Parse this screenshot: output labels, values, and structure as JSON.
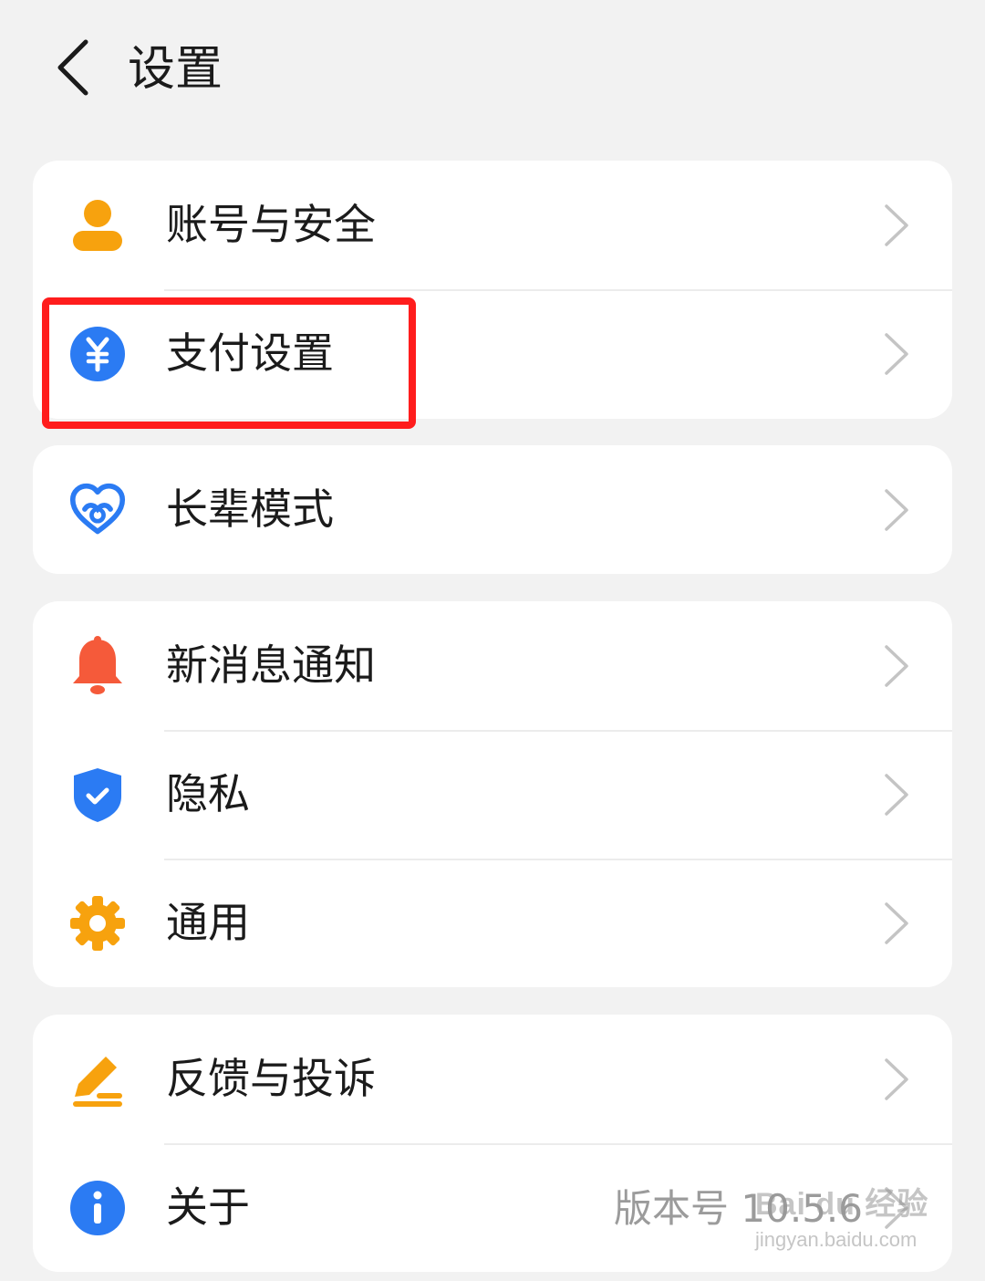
{
  "header": {
    "title": "设置",
    "back_icon": "chevron-left-icon"
  },
  "groups": [
    {
      "items": [
        {
          "label": "账号与安全",
          "icon": "person-icon",
          "icon_color": "#f7a20e"
        },
        {
          "label": "支付设置",
          "icon": "yuan-coin-icon",
          "icon_color": "#2b7bf3"
        }
      ]
    },
    {
      "items": [
        {
          "label": "长辈模式",
          "icon": "heart-hands-icon",
          "icon_color": "#2b7bf3"
        }
      ]
    },
    {
      "items": [
        {
          "label": "新消息通知",
          "icon": "bell-icon",
          "icon_color": "#f55a3a"
        },
        {
          "label": "隐私",
          "icon": "shield-check-icon",
          "icon_color": "#2b7bf3"
        },
        {
          "label": "通用",
          "icon": "gear-icon",
          "icon_color": "#f7a20e"
        }
      ]
    },
    {
      "items": [
        {
          "label": "反馈与投诉",
          "icon": "pencil-edit-icon",
          "icon_color": "#f7a20e"
        },
        {
          "label": "关于",
          "icon": "info-icon",
          "icon_color": "#2b7bf3",
          "value": "版本号 10.5.6"
        }
      ]
    }
  ],
  "annotation": {
    "highlighted_item": "支付设置",
    "color": "#ff1d1d"
  },
  "watermark": {
    "logo": "Bai du 经验",
    "url": "jingyan.baidu.com"
  }
}
